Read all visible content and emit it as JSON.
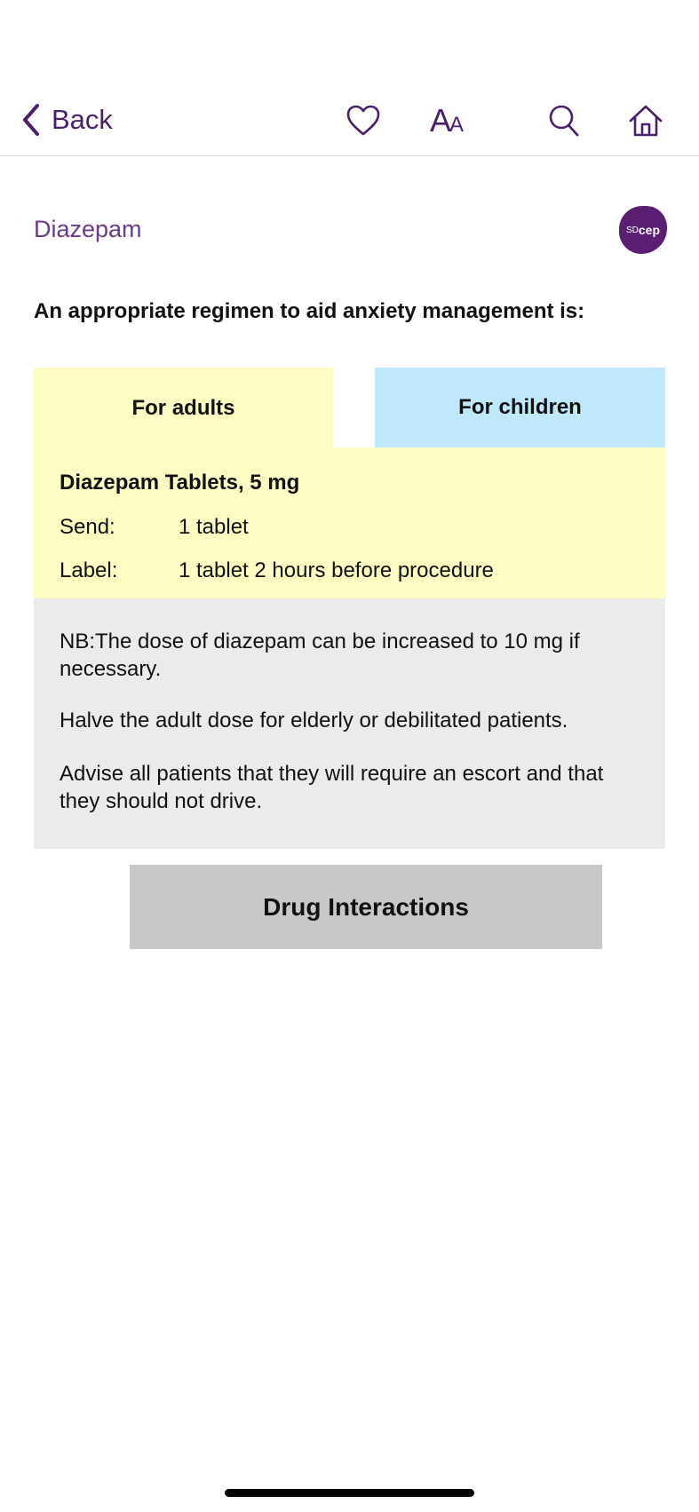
{
  "header": {
    "back_label": "Back",
    "icons": [
      "chevron-left-icon",
      "heart-icon",
      "text-size-icon",
      "search-icon",
      "home-icon"
    ],
    "text_size_large": "A",
    "text_size_small": "A"
  },
  "drug": {
    "title": "Diazepam",
    "logo_prefix": "SD",
    "logo_suffix": "cep"
  },
  "intro": "An appropriate regimen to aid anxiety management is:",
  "tabs": [
    {
      "label": "For adults",
      "selected": true,
      "color": "#fcfcc3"
    },
    {
      "label": "For children",
      "selected": false,
      "color": "#bfe8fb"
    }
  ],
  "regimen": {
    "name": "Diazepam Tablets, 5 mg",
    "send_key": "Send:",
    "send_value": "1 tablet",
    "label_key": "Label:",
    "label_value": "1 tablet 2 hours before procedure"
  },
  "notes": [
    "NB:The dose of diazepam can be increased to 10 mg if necessary.",
    "Halve the adult dose for elderly or debilitated patients.",
    "Advise all patients that they will require an escort and that they should not drive."
  ],
  "actions": {
    "drug_interactions_label": "Drug Interactions"
  },
  "colors": {
    "accent": "#4a1f6b",
    "title": "#6b3a8c",
    "notes_bg": "#ebebeb",
    "button_bg": "#c8c8c8"
  }
}
